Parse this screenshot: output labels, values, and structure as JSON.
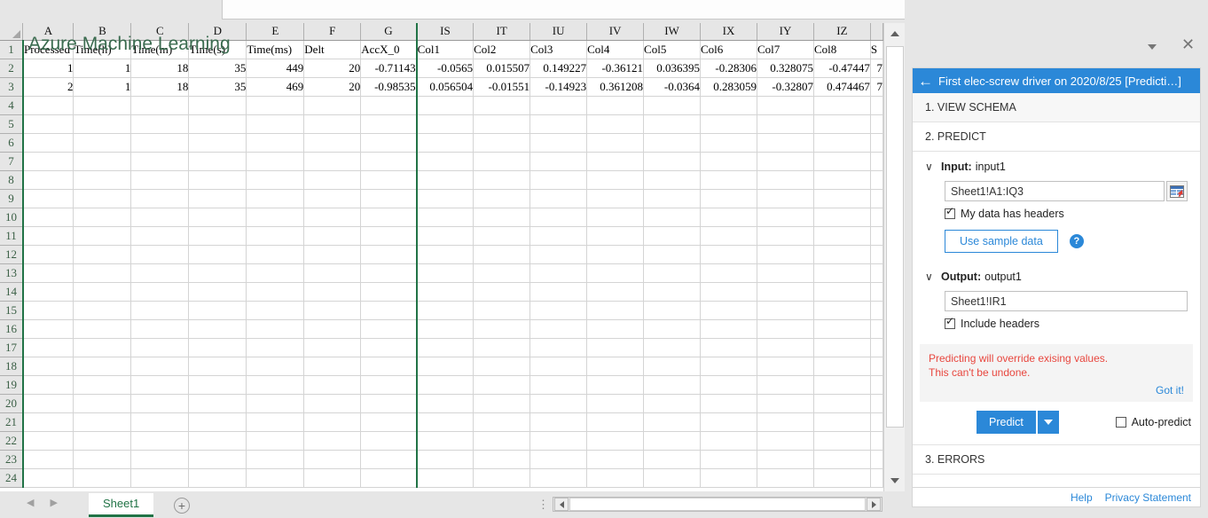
{
  "spreadsheet": {
    "column_headers_left": [
      "A",
      "B",
      "C",
      "D",
      "E",
      "F",
      "G"
    ],
    "column_headers_right": [
      "IS",
      "IT",
      "IU",
      "IV",
      "IW",
      "IX",
      "IY",
      "IZ"
    ],
    "clipped_column_header": "",
    "row_numbers": [
      1,
      2,
      3,
      4,
      5,
      6,
      7,
      8,
      9,
      10,
      11,
      12,
      13,
      14,
      15,
      16,
      17,
      18,
      19,
      20,
      21,
      22,
      23,
      24
    ],
    "header_row": {
      "left": [
        "Processed",
        "Time(h)",
        "Time(m)",
        "Time(s)",
        "Time(ms)",
        "Delt",
        "AccX_0"
      ],
      "right": [
        "Col1",
        "Col2",
        "Col3",
        "Col4",
        "Col5",
        "Col6",
        "Col7",
        "Col8"
      ],
      "clipped": "S"
    },
    "data_rows": [
      {
        "left": [
          "1",
          "1",
          "18",
          "35",
          "449",
          "20",
          "-0.71143"
        ],
        "right": [
          "-0.0565",
          "0.015507",
          "0.149227",
          "-0.36121",
          "0.036395",
          "-0.28306",
          "0.328075",
          "-0.47447"
        ],
        "clipped": "7"
      },
      {
        "left": [
          "2",
          "1",
          "18",
          "35",
          "469",
          "20",
          "-0.98535"
        ],
        "right": [
          "0.056504",
          "-0.01551",
          "-0.14923",
          "0.361208",
          "-0.0364",
          "0.283059",
          "-0.32807",
          "0.474467"
        ],
        "clipped": "7"
      }
    ],
    "sheet_tab": "Sheet1",
    "add_sheet_label": "+",
    "nav_prev": "◀",
    "nav_next": "▶",
    "selection_color": "#217346"
  },
  "pane": {
    "title": "Azure Machine Learning",
    "dropdown_icon": "chevron-down-icon",
    "close_icon": "close-icon",
    "breadcrumb": {
      "back_arrow": "←",
      "text": "First elec-screw driver on 2020/8/25 [Predicti…]"
    },
    "sections": [
      {
        "label": "1. VIEW SCHEMA"
      },
      {
        "label": "2. PREDICT"
      },
      {
        "label": "3. ERRORS"
      }
    ],
    "input": {
      "chevron": "∨",
      "label": "Input:",
      "name": "input1",
      "range_value": "Sheet1!A1:IQ3",
      "range_picker_icon": "range-select-icon",
      "headers_checkbox_label": "My data has headers",
      "headers_checked": true,
      "sample_data_button": "Use sample data",
      "help_icon": "?"
    },
    "output": {
      "chevron": "∨",
      "label": "Output:",
      "name": "output1",
      "range_value": "Sheet1!IR1",
      "headers_checkbox_label": "Include headers",
      "headers_checked": true
    },
    "warning": {
      "line1": "Predicting will override exising values.",
      "line2": "This can't be undone.",
      "dismiss": "Got it!",
      "color": "#e8473f"
    },
    "actions": {
      "predict_button": "Predict",
      "predict_dropdown_icon": "chevron-down-icon",
      "auto_predict_label": "Auto-predict",
      "auto_predict_checked": false,
      "accent_color": "#2b88d8"
    },
    "footer": {
      "help": "Help",
      "privacy": "Privacy Statement"
    }
  }
}
